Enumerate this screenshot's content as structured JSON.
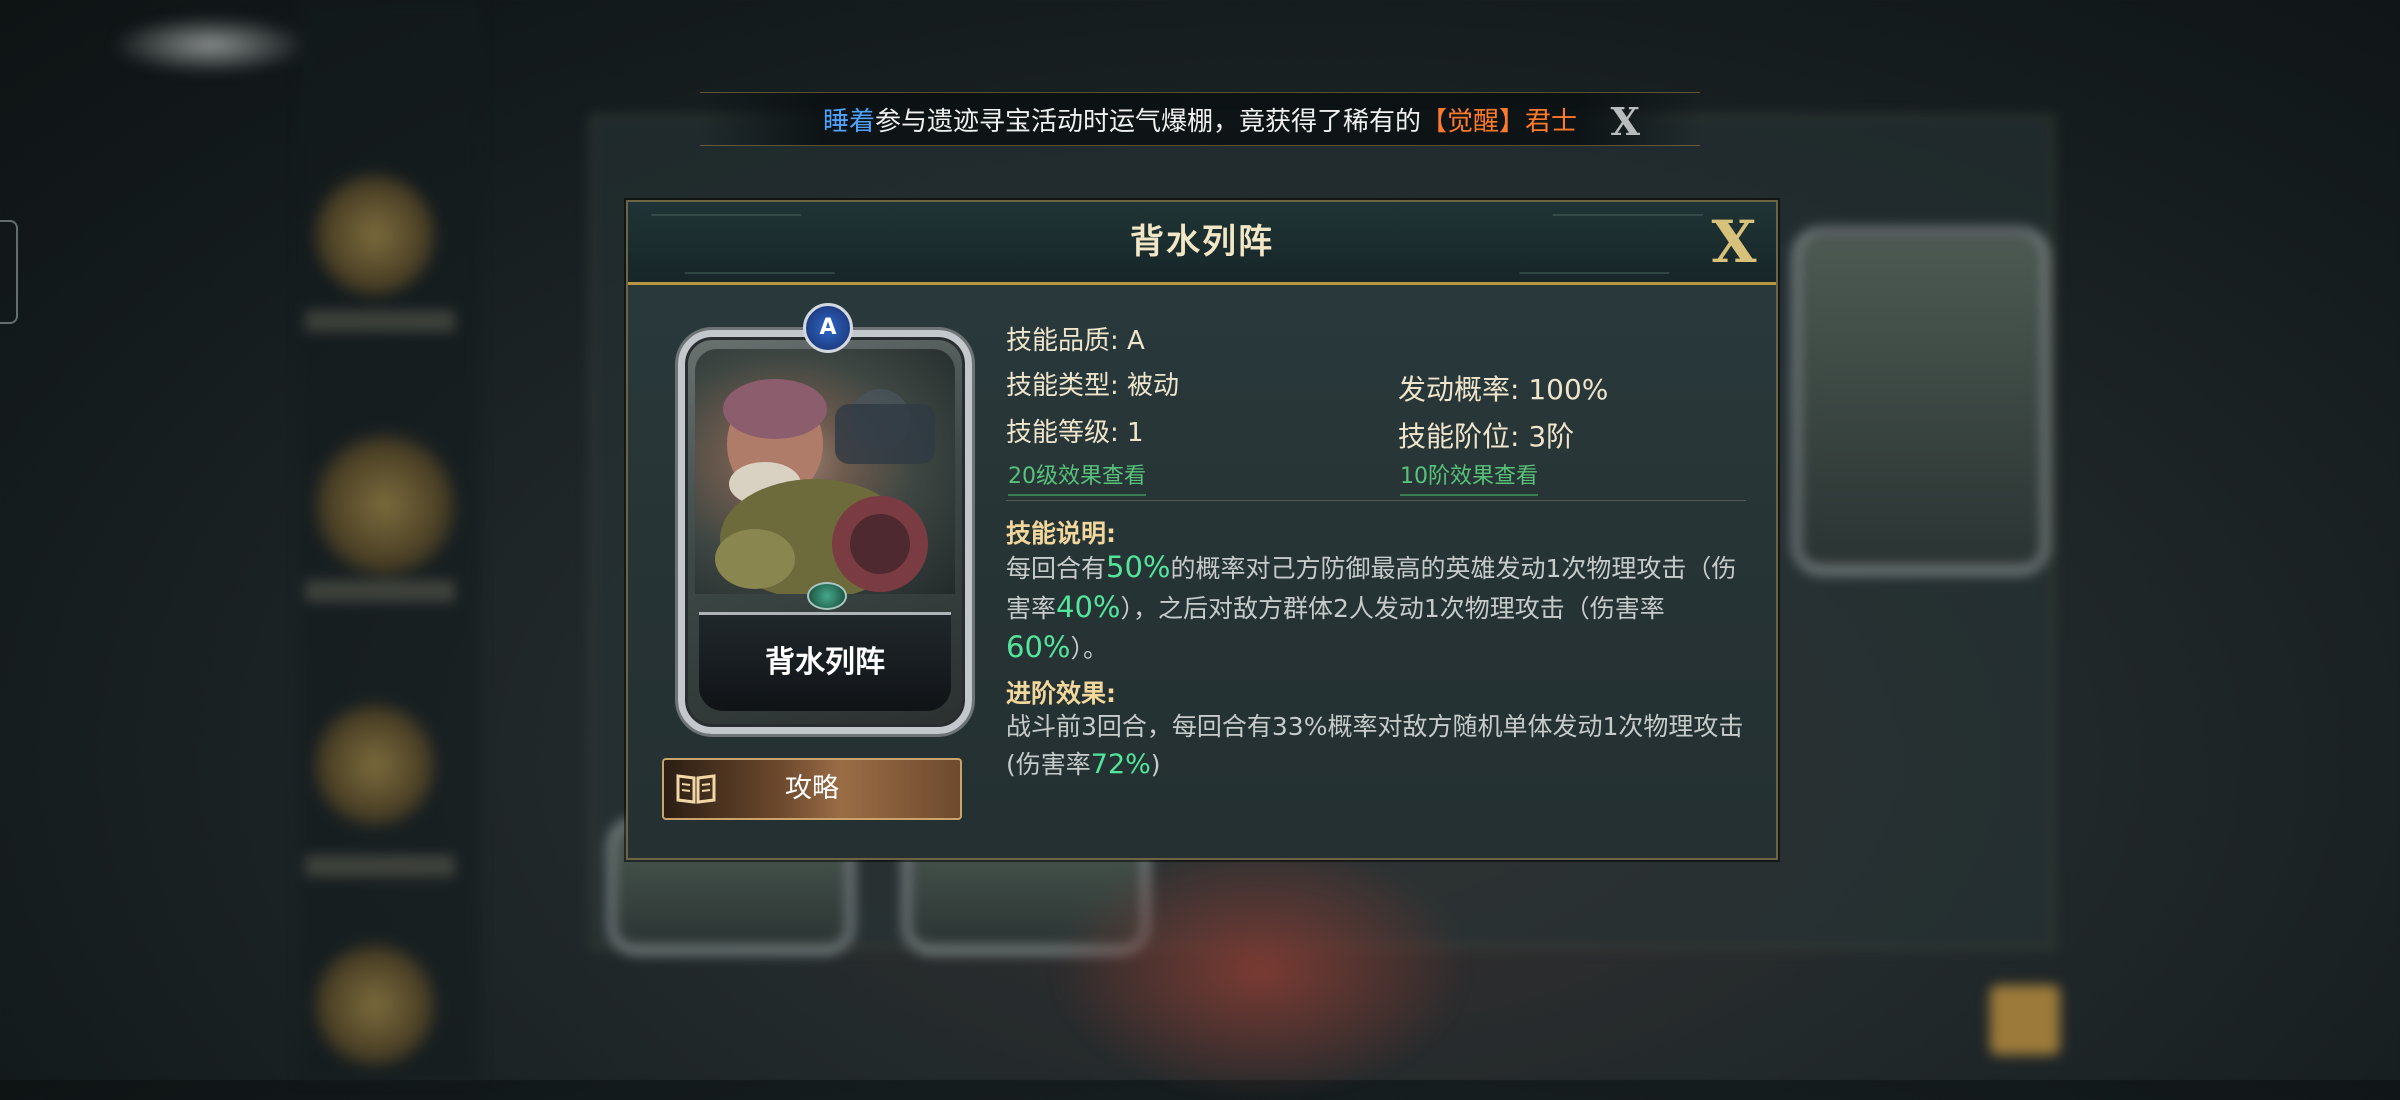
{
  "marquee": {
    "player_name": "睡着",
    "message": "参与遗迹寻宝活动时运气爆棚，竟获得了稀有的",
    "item_tag": "【觉醒】君士",
    "close_label": "X"
  },
  "dialog": {
    "title": "背水列阵",
    "close_label": "X",
    "card": {
      "badge": "A",
      "name": "背水列阵"
    },
    "guide_button": "攻略",
    "quality": "技能品质: A",
    "type": "技能类型: 被动",
    "trigger_rate": "发动概率: 100%",
    "level": "技能等级: 1",
    "tier": "技能阶位: 3阶",
    "level_link": "20级效果查看",
    "tier_link": "10阶效果查看",
    "description": {
      "title": "技能说明:",
      "t1": "每回合有",
      "v1": "50%",
      "t2": "的概率对己方防御最高的英雄发动1次物理攻击（伤害率",
      "v2": "40%",
      "t3": "），之后对敌方群体2人发动1次物理攻击（伤害率",
      "v3": "60%",
      "t4": "）。"
    },
    "advance": {
      "title": "进阶效果:",
      "t1": "战斗前3回合，每回合有33%概率对敌方随机单体发动1次物理攻击(伤害率",
      "v1": "72%",
      "t2": ")"
    }
  },
  "colors": {
    "highlight": "#53e59b",
    "link": "#58c27a",
    "player_name": "#4ea3ff",
    "item_tag": "#ff7a2a",
    "gold_border": "#b8963f"
  }
}
